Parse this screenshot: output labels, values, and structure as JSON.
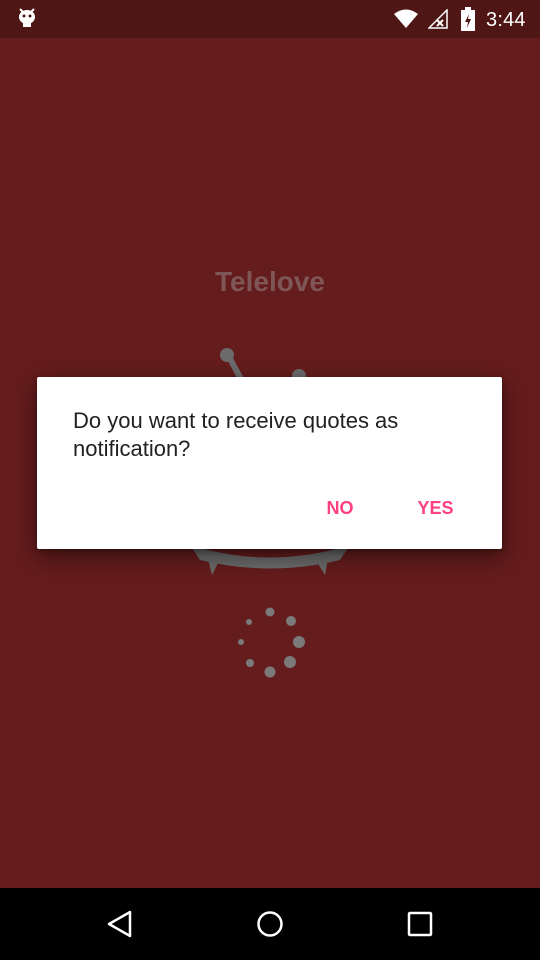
{
  "status_bar": {
    "time": "3:44",
    "icons": [
      "android-icon",
      "wifi-icon",
      "signal-icon",
      "battery-icon"
    ]
  },
  "app": {
    "title": "Telelove",
    "background_color": "#651c1c",
    "illustration": "tv-icon",
    "loading": "spinner-icon"
  },
  "dialog": {
    "message": "Do you want to receive quotes as notification?",
    "no_label": "NO",
    "yes_label": "YES",
    "accent_color": "#ff4081"
  },
  "nav_bar": {
    "items": [
      "back-icon",
      "home-icon",
      "recents-icon"
    ]
  }
}
